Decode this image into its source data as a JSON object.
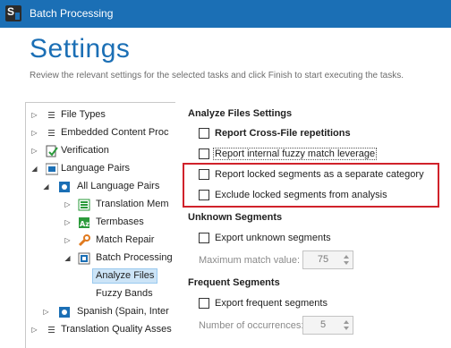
{
  "window": {
    "title": "Batch Processing",
    "app_icon_letter": "S"
  },
  "header": {
    "title": "Settings",
    "subtitle": "Review the relevant settings for the selected tasks and click Finish to start executing the tasks."
  },
  "tree": {
    "items": [
      {
        "label": "File Types",
        "icon": "settings-list-icon"
      },
      {
        "label": "Embedded Content Proc",
        "icon": "settings-list-icon"
      },
      {
        "label": "Verification",
        "icon": "verification-check-icon"
      },
      {
        "label": "Language Pairs",
        "icon": "language-pairs-icon"
      },
      {
        "label": "All Language Pairs",
        "icon": "language-pair-icon"
      },
      {
        "label": "Translation Mem",
        "icon": "translation-memory-icon"
      },
      {
        "label": "Termbases",
        "icon": "termbase-icon"
      },
      {
        "label": "Match Repair",
        "icon": "wrench-icon"
      },
      {
        "label": "Batch Processing",
        "icon": "batch-processing-icon"
      },
      {
        "label": "Analyze Files",
        "icon": ""
      },
      {
        "label": "Fuzzy Bands",
        "icon": ""
      },
      {
        "label": "Spanish (Spain, Inter",
        "icon": "language-pair-icon"
      },
      {
        "label": "Translation Quality Asses",
        "icon": "settings-list-icon"
      }
    ]
  },
  "analyze": {
    "title": "Analyze Files Settings",
    "report_cross_file": "Report Cross-File repetitions",
    "report_internal_fuzzy": "Report internal fuzzy match leverage",
    "report_locked": "Report locked segments as a separate category",
    "exclude_locked": "Exclude locked segments from analysis"
  },
  "unknown": {
    "title": "Unknown Segments",
    "export_label": "Export unknown segments",
    "max_match_label": "Maximum match value:",
    "max_match_value": "75"
  },
  "frequent": {
    "title": "Frequent Segments",
    "export_label": "Export frequent segments",
    "occurrences_label": "Number of occurrences:",
    "occurrences_value": "5"
  },
  "colors": {
    "accent": "#1b6fb5",
    "highlight": "#d0222b",
    "selection": "#cce4f7"
  }
}
